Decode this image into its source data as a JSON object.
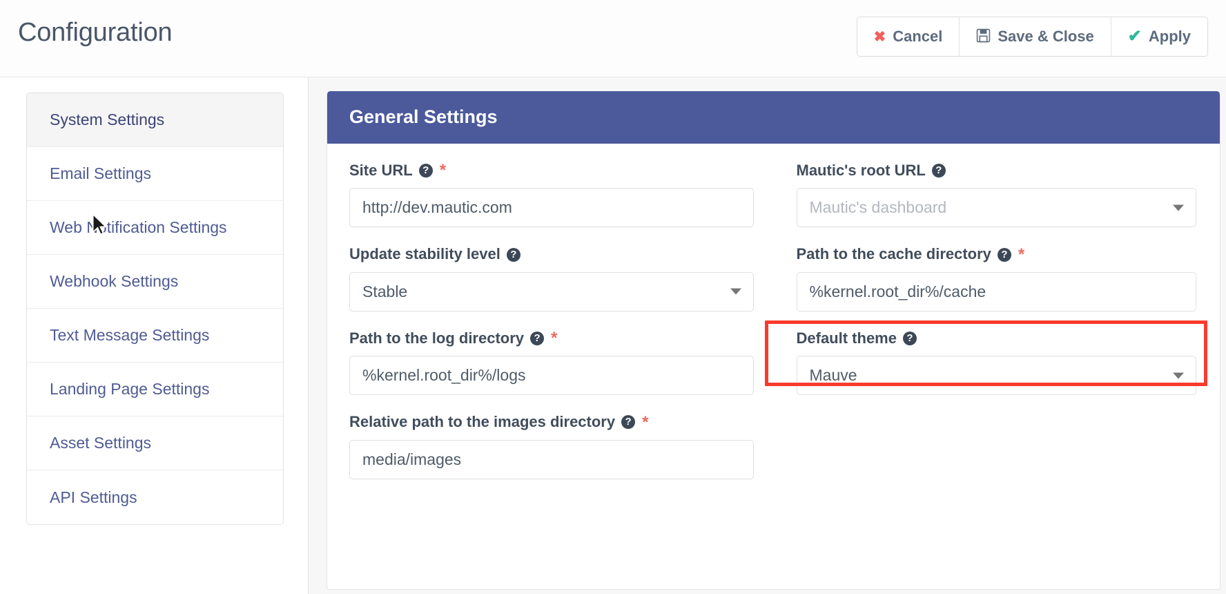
{
  "header": {
    "title": "Configuration",
    "buttons": [
      {
        "label": "Cancel",
        "icon": "close-icon",
        "glyph": "✖"
      },
      {
        "label": "Save & Close",
        "icon": "floppy-disk-icon",
        "glyph": "὚B"
      },
      {
        "label": "Apply",
        "icon": "check-icon",
        "glyph": "✔"
      }
    ]
  },
  "sidebar": {
    "items": [
      {
        "label": "System Settings",
        "active": true
      },
      {
        "label": "Email Settings",
        "active": false
      },
      {
        "label": "Web Notification Settings",
        "active": false
      },
      {
        "label": "Webhook Settings",
        "active": false
      },
      {
        "label": "Text Message Settings",
        "active": false
      },
      {
        "label": "Landing Page Settings",
        "active": false
      },
      {
        "label": "Asset Settings",
        "active": false
      },
      {
        "label": "API Settings",
        "active": false
      }
    ]
  },
  "panel": {
    "title": "General Settings",
    "fields": {
      "site_url": {
        "label": "Site URL",
        "value": "http://dev.mautic.com",
        "required": true,
        "help": "?"
      },
      "root_url": {
        "label": "Mautic's root URL",
        "placeholder": "Mautic's dashboard",
        "value": "",
        "required": false,
        "help": "?"
      },
      "stability": {
        "label": "Update stability level",
        "value": "Stable",
        "required": false,
        "help": "?"
      },
      "cache_path": {
        "label": "Path to the cache directory",
        "value": "%kernel.root_dir%/cache",
        "required": true,
        "help": "?"
      },
      "log_path": {
        "label": "Path to the log directory",
        "value": "%kernel.root_dir%/logs",
        "required": true,
        "help": "?"
      },
      "default_theme": {
        "label": "Default theme",
        "value": "Mauve",
        "required": false,
        "help": "?"
      },
      "images_path": {
        "label": "Relative path to the images directory",
        "value": "media/images",
        "required": true,
        "help": "?"
      }
    }
  },
  "annotation": {
    "highlight_color": "#f83b2e",
    "target": "default-theme-field"
  },
  "colors": {
    "panel_header": "#4c5a9b",
    "link": "#4f5b93",
    "required_star": "#ef6a5e",
    "cancel_icon": "#f0605c",
    "apply_icon": "#2fb89a"
  }
}
